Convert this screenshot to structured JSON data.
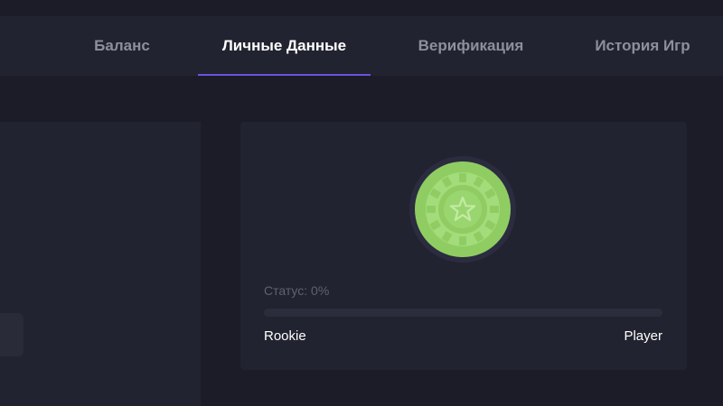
{
  "tabs": [
    {
      "label": "Баланс",
      "active": false
    },
    {
      "label": "Личные Данные",
      "active": true
    },
    {
      "label": "Верификация",
      "active": false
    },
    {
      "label": "История Игр",
      "active": false
    }
  ],
  "status": {
    "label": "Статус: 0%",
    "progress_percent": 0,
    "rank_start": "Rookie",
    "rank_end": "Player",
    "icon": "roulette-chip-star-icon"
  },
  "colors": {
    "background": "#1b1c27",
    "panel": "#222330",
    "accent": "#6a52e0",
    "chip_green": "#8fcd63",
    "text_muted": "#8d8f9e"
  }
}
